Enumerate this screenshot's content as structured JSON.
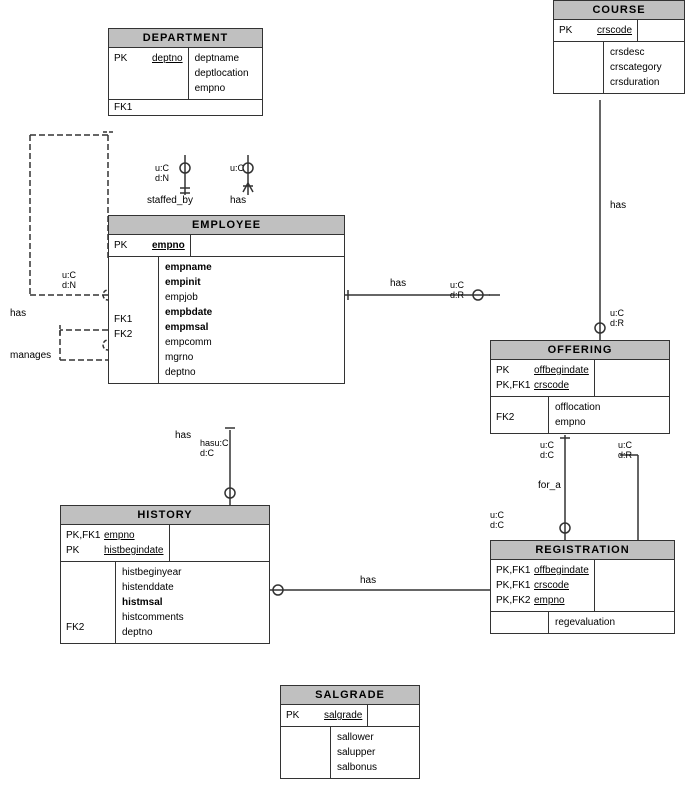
{
  "entities": {
    "department": {
      "title": "DEPARTMENT",
      "pk_rows": [
        {
          "label": "PK",
          "value": "deptno",
          "underline": true
        }
      ],
      "attrs": [
        {
          "text": "deptname",
          "bold": false
        },
        {
          "text": "deptlocation",
          "bold": false
        },
        {
          "text": "empno",
          "bold": false
        }
      ],
      "fk_rows": [
        {
          "label": "FK1",
          "value": ""
        }
      ]
    },
    "course": {
      "title": "COURSE",
      "pk_rows": [
        {
          "label": "PK",
          "value": "crscode",
          "underline": true
        }
      ],
      "attrs": [
        {
          "text": "crsdesc",
          "bold": false
        },
        {
          "text": "crscategory",
          "bold": false
        },
        {
          "text": "crsduration",
          "bold": false
        }
      ]
    },
    "employee": {
      "title": "EMPLOYEE",
      "pk_rows": [
        {
          "label": "PK",
          "value": "empno",
          "underline": true
        }
      ],
      "attrs": [
        {
          "text": "empname",
          "bold": true
        },
        {
          "text": "empinit",
          "bold": true
        },
        {
          "text": "empjob",
          "bold": false
        },
        {
          "text": "empbdate",
          "bold": true
        },
        {
          "text": "empmsal",
          "bold": true
        },
        {
          "text": "empcomm",
          "bold": false
        },
        {
          "text": "mgrno",
          "bold": false
        },
        {
          "text": "deptno",
          "bold": false
        }
      ],
      "fk_rows": [
        {
          "label": "FK1",
          "value": ""
        },
        {
          "label": "FK2",
          "value": ""
        }
      ]
    },
    "offering": {
      "title": "OFFERING",
      "pk_rows": [
        {
          "label": "PK",
          "value": "offbegindate",
          "underline": true
        },
        {
          "label": "PK,FK1",
          "value": "crscode",
          "underline": true
        }
      ],
      "attrs": [
        {
          "text": "offlocation",
          "bold": false
        },
        {
          "text": "empno",
          "bold": false
        }
      ],
      "fk_rows": [
        {
          "label": "FK2",
          "value": ""
        }
      ]
    },
    "history": {
      "title": "HISTORY",
      "pk_rows": [
        {
          "label": "PK,FK1",
          "value": "empno",
          "underline": true
        },
        {
          "label": "PK",
          "value": "histbegindate",
          "underline": true
        }
      ],
      "attrs": [
        {
          "text": "histbeginyear",
          "bold": false
        },
        {
          "text": "histenddate",
          "bold": false
        },
        {
          "text": "histmsal",
          "bold": true
        },
        {
          "text": "histcomments",
          "bold": false
        },
        {
          "text": "deptno",
          "bold": false
        }
      ],
      "fk_rows": [
        {
          "label": "FK2",
          "value": ""
        }
      ]
    },
    "registration": {
      "title": "REGISTRATION",
      "pk_rows": [
        {
          "label": "PK,FK1",
          "value": "offbegindate",
          "underline": true
        },
        {
          "label": "PK,FK1",
          "value": "crscode",
          "underline": true
        },
        {
          "label": "PK,FK2",
          "value": "empno",
          "underline": true
        }
      ],
      "attrs": [
        {
          "text": "regevaluation",
          "bold": false
        }
      ]
    },
    "salgrade": {
      "title": "SALGRADE",
      "pk_rows": [
        {
          "label": "PK",
          "value": "salgrade",
          "underline": true
        }
      ],
      "attrs": [
        {
          "text": "sallower",
          "bold": false
        },
        {
          "text": "salupper",
          "bold": false
        },
        {
          "text": "salbonus",
          "bold": false
        }
      ]
    }
  },
  "labels": {
    "staffed_by": "staffed_by",
    "has_dept_emp": "has",
    "has_emp_off": "has",
    "has_emp_hist": "has",
    "for_a": "for_a",
    "has_reg": "has",
    "manages": "manages",
    "has_left": "has",
    "u_c": "u:C",
    "d_n": "d:N",
    "d_r": "d:R",
    "hasu_c": "hasu:C",
    "hasd_c": "d:C"
  }
}
